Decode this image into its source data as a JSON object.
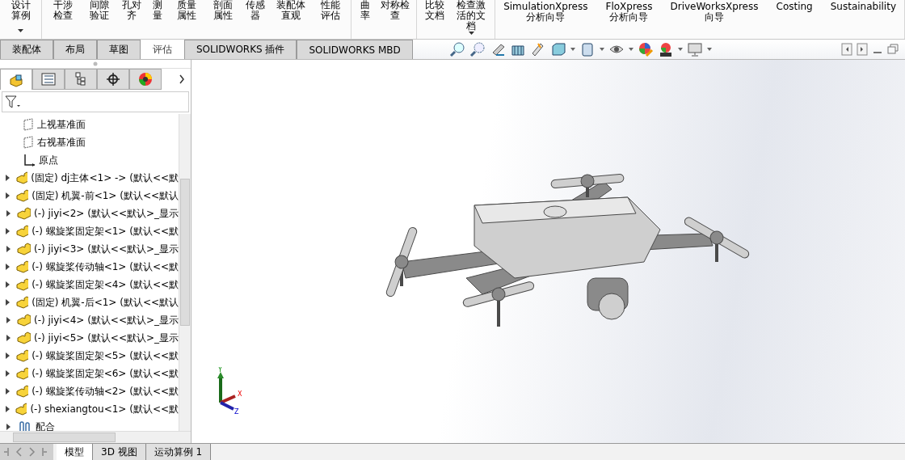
{
  "ribbon": {
    "groups": [
      {
        "kind": "cjk",
        "items": [
          {
            "label": "设计算例",
            "dropdown": true
          }
        ]
      },
      {
        "kind": "cjk",
        "items": [
          {
            "label": "干涉检查",
            "dropdown": false
          },
          {
            "label": "间隙验证",
            "dropdown": false
          },
          {
            "label": "孔对齐",
            "dropdown": false
          },
          {
            "label": "测量",
            "dropdown": false
          },
          {
            "label": "质量属性",
            "dropdown": false
          },
          {
            "label": "剖面属性",
            "dropdown": false
          },
          {
            "label": "传感器",
            "dropdown": false
          },
          {
            "label": "装配体直观",
            "dropdown": false
          },
          {
            "label": "性能评估",
            "dropdown": false
          }
        ]
      },
      {
        "kind": "cjk",
        "items": [
          {
            "label": "曲率",
            "dropdown": false
          },
          {
            "label": "对称检查",
            "dropdown": false
          }
        ]
      },
      {
        "kind": "cjk",
        "items": [
          {
            "label": "比较文档",
            "dropdown": false
          },
          {
            "label": "检查激活的文档",
            "dropdown": true
          }
        ]
      },
      {
        "kind": "latin",
        "items": [
          {
            "label": "SimulationXpress 分析向导",
            "dropdown": false
          },
          {
            "label": "FloXpress 分析向导",
            "dropdown": false
          },
          {
            "label": "DriveWorksXpress 向导",
            "dropdown": false
          },
          {
            "label": "Costing",
            "dropdown": false
          },
          {
            "label": "Sustainability",
            "dropdown": false
          }
        ]
      }
    ]
  },
  "tabs": [
    {
      "label": "装配体",
      "selected": false
    },
    {
      "label": "布局",
      "selected": false
    },
    {
      "label": "草图",
      "selected": false
    },
    {
      "label": "评估",
      "selected": true
    },
    {
      "label": "SOLIDWORKS 插件",
      "selected": false
    },
    {
      "label": "SOLIDWORKS MBD",
      "selected": false
    }
  ],
  "panel_tabs": [
    {
      "kind": "tree",
      "selected": true
    },
    {
      "kind": "property",
      "selected": false
    },
    {
      "kind": "config",
      "selected": false
    },
    {
      "kind": "dimxpert",
      "selected": false
    },
    {
      "kind": "display",
      "selected": false
    }
  ],
  "tree": [
    {
      "kind": "plane",
      "label": "上视基准面"
    },
    {
      "kind": "plane",
      "label": "右视基准面"
    },
    {
      "kind": "origin",
      "label": "原点"
    },
    {
      "kind": "part",
      "label": "(固定) dj主体<1> -> (默认<<默",
      "expanded": false
    },
    {
      "kind": "part",
      "label": "(固定) 机翼-前<1> (默认<<默认",
      "expanded": false
    },
    {
      "kind": "part",
      "label": "(-) jiyi<2> (默认<<默认>_显示",
      "expanded": false
    },
    {
      "kind": "part",
      "label": "(-) 螺旋桨固定架<1> (默认<<默",
      "expanded": false
    },
    {
      "kind": "part",
      "label": "(-) jiyi<3> (默认<<默认>_显示",
      "expanded": false
    },
    {
      "kind": "part",
      "label": "(-) 螺旋桨传动轴<1> (默认<<默",
      "expanded": false
    },
    {
      "kind": "part",
      "label": "(-) 螺旋桨固定架<4> (默认<<默",
      "expanded": false
    },
    {
      "kind": "part",
      "label": "(固定) 机翼-后<1> (默认<<默认",
      "expanded": false
    },
    {
      "kind": "part",
      "label": "(-) jiyi<4> (默认<<默认>_显示",
      "expanded": false
    },
    {
      "kind": "part",
      "label": "(-) jiyi<5> (默认<<默认>_显示",
      "expanded": false
    },
    {
      "kind": "part",
      "label": "(-) 螺旋桨固定架<5> (默认<<默",
      "expanded": false
    },
    {
      "kind": "part",
      "label": "(-) 螺旋桨固定架<6> (默认<<默",
      "expanded": false
    },
    {
      "kind": "part",
      "label": "(-) 螺旋桨传动轴<2> (默认<<默",
      "expanded": false
    },
    {
      "kind": "part",
      "label": "(-) shexiangtou<1> (默认<<默",
      "expanded": false
    },
    {
      "kind": "mates",
      "label": "配合",
      "expanded": false
    }
  ],
  "triad": {
    "x": "X",
    "y": "Y",
    "z": "Z"
  },
  "bottom_tabs": [
    {
      "label": "模型",
      "selected": true
    },
    {
      "label": "3D 视图",
      "selected": false
    },
    {
      "label": "运动算例 1",
      "selected": false
    }
  ]
}
